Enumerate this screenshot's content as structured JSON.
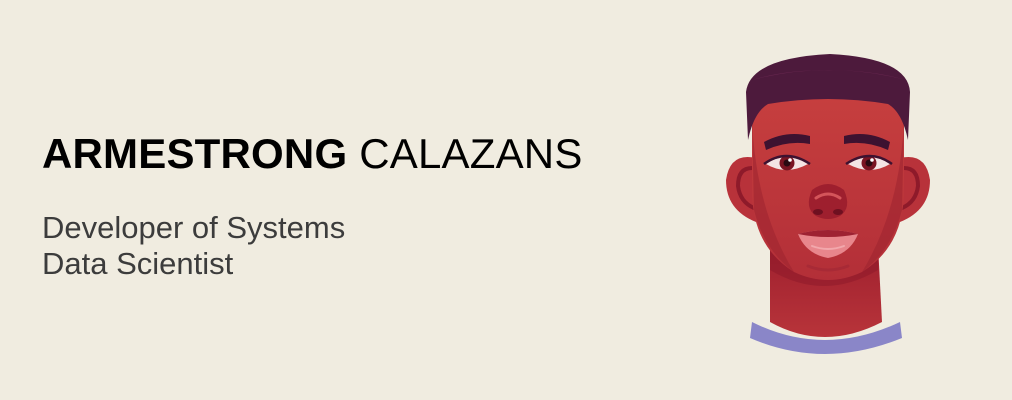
{
  "profile": {
    "first_name": "ARMESTRONG",
    "last_name": "CALAZANS",
    "roles": [
      "Developer of Systems",
      "Data Scientist"
    ]
  },
  "avatar": {
    "icon": "person-avatar-illustration",
    "colors": {
      "skin": "#c0363a",
      "skin_shadow": "#8e1a2a",
      "hair": "#4d1a3c",
      "shirt": "#8a86c8",
      "background": "#f0ece0"
    }
  }
}
